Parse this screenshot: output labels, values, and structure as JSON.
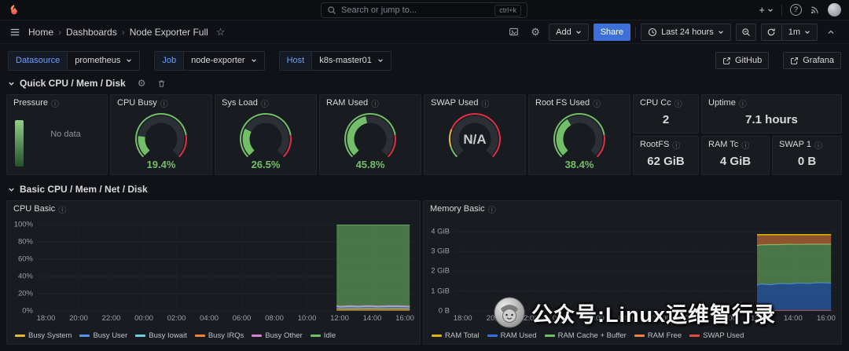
{
  "topbar": {
    "search": {
      "placeholder": "Search or jump to...",
      "shortcut": "ctrl+k"
    },
    "new_label": "+"
  },
  "icons": {
    "help": "?",
    "gear": "⚙",
    "star": "☆",
    "info": "ⓘ",
    "breadcrumb_separator": "›"
  },
  "breadcrumb": {
    "items": [
      "Home",
      "Dashboards",
      "Node Exporter Full"
    ]
  },
  "toolbar": {
    "add_label": "Add",
    "share_label": "Share",
    "time_range": "Last 24 hours",
    "refresh_interval": "1m"
  },
  "filters": {
    "datasource": {
      "label": "Datasource",
      "value": "prometheus"
    },
    "job": {
      "label": "Job",
      "value": "node-exporter"
    },
    "host": {
      "label": "Host",
      "value": "k8s-master01"
    },
    "links": [
      {
        "label": "GitHub"
      },
      {
        "label": "Grafana"
      }
    ]
  },
  "rows": {
    "quick": {
      "title": "Quick CPU / Mem / Disk"
    },
    "basic": {
      "title": "Basic CPU / Mem / Net / Disk"
    }
  },
  "quick_panels": {
    "pressure": {
      "title": "Pressure",
      "status": "No data"
    },
    "gauges": [
      {
        "title": "CPU Busy",
        "value": "19.4%",
        "percent": 19.4,
        "color": "#73BF69",
        "thresholds": [
          {
            "from": 0,
            "to": 80,
            "color": "#73BF69"
          },
          {
            "from": 80,
            "to": 100,
            "color": "#E02F44"
          }
        ]
      },
      {
        "title": "Sys Load",
        "value": "26.5%",
        "percent": 26.5,
        "color": "#73BF69",
        "thresholds": [
          {
            "from": 0,
            "to": 80,
            "color": "#73BF69"
          },
          {
            "from": 80,
            "to": 100,
            "color": "#E02F44"
          }
        ]
      },
      {
        "title": "RAM Used",
        "value": "45.8%",
        "percent": 45.8,
        "color": "#73BF69",
        "thresholds": [
          {
            "from": 0,
            "to": 80,
            "color": "#73BF69"
          },
          {
            "from": 80,
            "to": 100,
            "color": "#E02F44"
          }
        ]
      },
      {
        "title": "SWAP Used",
        "value": "N/A",
        "percent": null,
        "color": "#73BF69",
        "thresholds": [
          {
            "from": 0,
            "to": 10,
            "color": "#73BF69"
          },
          {
            "from": 10,
            "to": 25,
            "color": "#EAB839"
          },
          {
            "from": 25,
            "to": 100,
            "color": "#E02F44"
          }
        ]
      },
      {
        "title": "Root FS Used",
        "value": "38.4%",
        "percent": 38.4,
        "color": "#73BF69",
        "thresholds": [
          {
            "from": 0,
            "to": 80,
            "color": "#73BF69"
          },
          {
            "from": 80,
            "to": 100,
            "color": "#E02F44"
          }
        ]
      }
    ],
    "stats": [
      {
        "title": "CPU Cc",
        "value": "2"
      },
      {
        "title": "Uptime",
        "value": "7.1 hours"
      },
      {
        "title": "RootFS",
        "value": "62 GiB"
      },
      {
        "title": "RAM Tc",
        "value": "4 GiB"
      },
      {
        "title": "SWAP 1",
        "value": "0 B"
      }
    ]
  },
  "chart_data": [
    {
      "type": "area",
      "title": "CPU Basic",
      "stacked": true,
      "ylim": [
        0,
        100
      ],
      "yticks": [
        {
          "v": 0,
          "label": "0%"
        },
        {
          "v": 20,
          "label": "20%"
        },
        {
          "v": 40,
          "label": "40%"
        },
        {
          "v": 60,
          "label": "60%"
        },
        {
          "v": 80,
          "label": "80%"
        },
        {
          "v": 100,
          "label": "100%"
        }
      ],
      "xticks": [
        "18:00",
        "20:00",
        "22:00",
        "00:00",
        "02:00",
        "04:00",
        "06:00",
        "08:00",
        "10:00",
        "12:00",
        "14:00",
        "16:00"
      ],
      "legend_position": "bottom",
      "x": [
        0.795,
        0.805,
        0.83,
        0.855,
        0.88,
        0.905,
        0.93,
        0.955,
        0.99
      ],
      "series": [
        {
          "name": "Busy System",
          "color": "#EAB839",
          "mode": "stack",
          "values": [
            2.6,
            2.3,
            2.5,
            2.4,
            2.7,
            2.4,
            2.5,
            2.6,
            2.4
          ]
        },
        {
          "name": "Busy User",
          "color": "#5794F2",
          "mode": "stack",
          "values": [
            2.2,
            1.9,
            2.1,
            2.0,
            2.2,
            2.0,
            2.1,
            2.2,
            2.0
          ]
        },
        {
          "name": "Busy Iowait",
          "color": "#6ED0E0",
          "mode": "stack",
          "values": [
            0.5,
            0.4,
            0.5,
            0.4,
            0.5,
            0.4,
            0.5,
            0.4,
            0.4
          ]
        },
        {
          "name": "Busy IRQs",
          "color": "#EF843C",
          "mode": "stack",
          "values": [
            0.6,
            0.5,
            0.6,
            0.5,
            0.6,
            0.5,
            0.6,
            0.5,
            0.5
          ]
        },
        {
          "name": "Busy Other",
          "color": "#D683CE",
          "mode": "stack",
          "values": [
            0.3,
            0.3,
            0.3,
            0.3,
            0.3,
            0.3,
            0.3,
            0.3,
            0.3
          ]
        },
        {
          "name": "Idle",
          "color": "#73BF69",
          "mode": "stack",
          "values": [
            93.8,
            94.6,
            94.0,
            94.4,
            93.7,
            94.4,
            94.0,
            94.0,
            94.4
          ]
        }
      ]
    },
    {
      "type": "area",
      "title": "Memory Basic",
      "stacked": true,
      "unit": "GiB",
      "ylim": [
        0,
        4.35
      ],
      "yticks": [
        {
          "v": 0,
          "label": "0 B"
        },
        {
          "v": 1,
          "label": "1 GiB"
        },
        {
          "v": 2,
          "label": "2 GiB"
        },
        {
          "v": 3,
          "label": "3 GiB"
        },
        {
          "v": 4,
          "label": "4 GiB"
        }
      ],
      "xticks": [
        "18:00",
        "20:00",
        "22:00",
        "00:00",
        "02:00",
        "04:00",
        "06:00",
        "08:00",
        "10:00",
        "12:00",
        "14:00",
        "16:00"
      ],
      "legend_position": "bottom",
      "x": [
        0.795,
        0.805,
        0.83,
        0.855,
        0.88,
        0.905,
        0.93,
        0.955,
        0.99
      ],
      "series": [
        {
          "name": "RAM Total",
          "color": "#E0B400",
          "mode": "line",
          "values": [
            3.84,
            3.84,
            3.84,
            3.84,
            3.84,
            3.84,
            3.84,
            3.84,
            3.84
          ]
        },
        {
          "name": "RAM Used",
          "color": "#3274D9",
          "mode": "stack",
          "values": [
            1.3,
            1.35,
            1.32,
            1.38,
            1.36,
            1.4,
            1.38,
            1.42,
            1.4
          ]
        },
        {
          "name": "RAM Cache + Buffer",
          "color": "#73BF69",
          "mode": "stack",
          "values": [
            2.0,
            1.98,
            2.02,
            1.96,
            2.0,
            1.95,
            1.98,
            1.94,
            1.96
          ]
        },
        {
          "name": "RAM Free",
          "color": "#EF843C",
          "mode": "stack",
          "values": [
            0.54,
            0.51,
            0.5,
            0.5,
            0.48,
            0.49,
            0.48,
            0.48,
            0.48
          ]
        },
        {
          "name": "SWAP Used",
          "color": "#E24D42",
          "mode": "line",
          "values": [
            0,
            0,
            0,
            0,
            0,
            0,
            0,
            0,
            0
          ]
        }
      ]
    }
  ],
  "watermark": {
    "text": "公众号:Linux运维智行录"
  }
}
